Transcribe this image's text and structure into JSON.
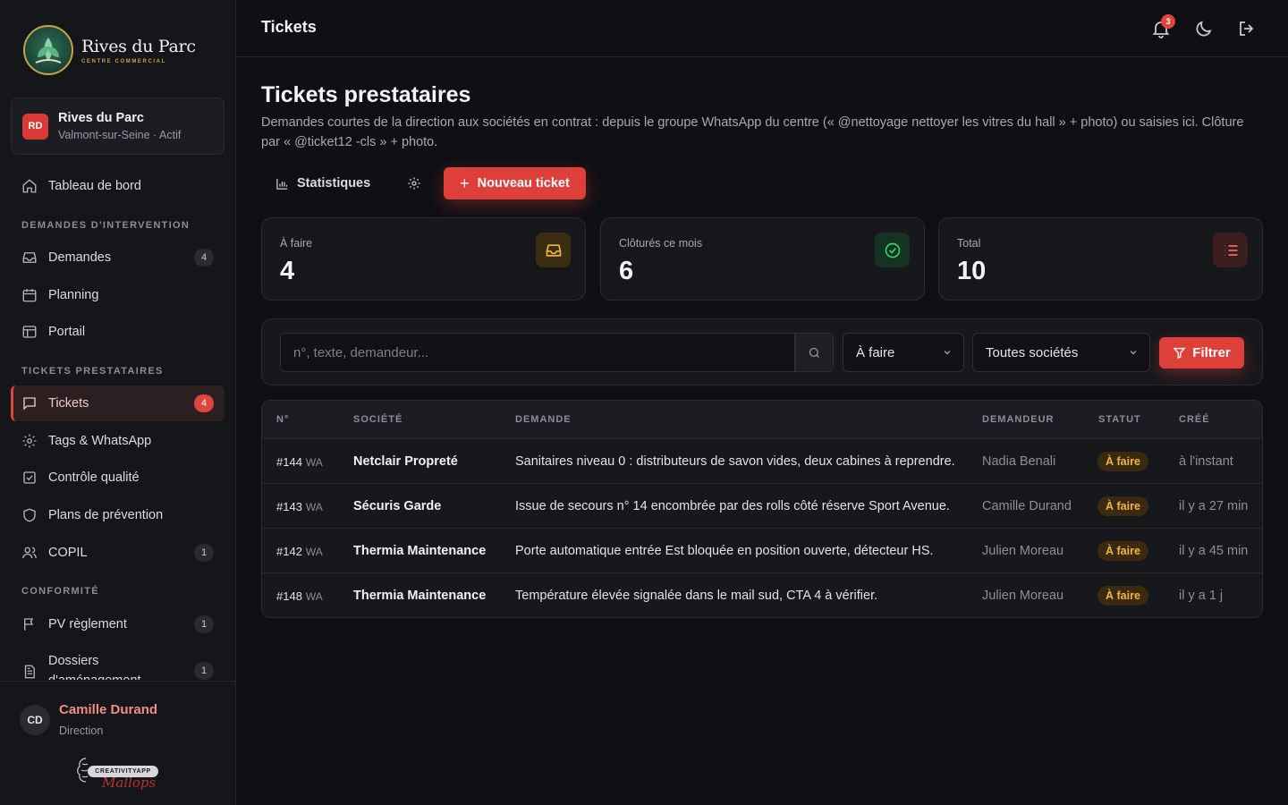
{
  "brand": {
    "name": "Rives du Parc",
    "subtitle": "CENTRE COMMERCIAL"
  },
  "org": {
    "initials": "RD",
    "name": "Rives du Parc",
    "meta": "Valmont-sur-Seine · Actif"
  },
  "nav": {
    "dashboard": "Tableau de bord",
    "section_interventions": "DEMANDES D'INTERVENTION",
    "demandes": {
      "label": "Demandes",
      "count": "4"
    },
    "planning": "Planning",
    "portail": "Portail",
    "section_tickets": "TICKETS PRESTATAIRES",
    "tickets": {
      "label": "Tickets",
      "count": "4"
    },
    "tags": "Tags & WhatsApp",
    "quality": "Contrôle qualité",
    "prevention": "Plans de prévention",
    "copil": {
      "label": "COPIL",
      "count": "1"
    },
    "section_conformity": "CONFORMITÉ",
    "pv": {
      "label": "PV règlement",
      "count": "1"
    },
    "dossiers": {
      "label": "Dossiers d'aménagement",
      "count": "1"
    }
  },
  "user": {
    "initials": "CD",
    "name": "Camille Durand",
    "role": "Direction"
  },
  "made_by": {
    "pill": "CREATIVITYAPP",
    "signature": "Mallops"
  },
  "topbar": {
    "title": "Tickets",
    "notifications": "3"
  },
  "page": {
    "title": "Tickets prestataires",
    "description": "Demandes courtes de la direction aux sociétés en contrat : depuis le groupe WhatsApp du centre (« @nettoyage nettoyer les vitres du hall » + photo) ou saisies ici. Clôture par « @ticket12 -cls » + photo."
  },
  "actions": {
    "stats": "Statistiques",
    "new_ticket": "Nouveau ticket"
  },
  "stats": [
    {
      "label": "À faire",
      "value": "4",
      "color": "#f1b53c"
    },
    {
      "label": "Clôturés ce mois",
      "value": "6",
      "color": "#3ecf6e"
    },
    {
      "label": "Total",
      "value": "10",
      "color": "#ef6b63"
    }
  ],
  "filters": {
    "search_placeholder": "n°, texte, demandeur...",
    "status": "À faire",
    "company": "Toutes sociétés",
    "filter_button": "Filtrer"
  },
  "table": {
    "headers": [
      "N°",
      "SOCIÉTÉ",
      "DEMANDE",
      "DEMANDEUR",
      "STATUT",
      "CRÉÉ"
    ],
    "rows": [
      {
        "num": "#144",
        "source": "WA",
        "company": "Netclair Propreté",
        "request": "Sanitaires niveau 0 : distributeurs de savon vides, deux cabines à reprendre.",
        "requester": "Nadia Benali",
        "status": "À faire",
        "created": "à l'instant"
      },
      {
        "num": "#143",
        "source": "WA",
        "company": "Sécuris Garde",
        "request": "Issue de secours n° 14 encombrée par des rolls côté réserve Sport Avenue.",
        "requester": "Camille Durand",
        "status": "À faire",
        "created": "il y a 27 min"
      },
      {
        "num": "#142",
        "source": "WA",
        "company": "Thermia Maintenance",
        "request": "Porte automatique entrée Est bloquée en position ouverte, détecteur HS.",
        "requester": "Julien Moreau",
        "status": "À faire",
        "created": "il y a 45 min"
      },
      {
        "num": "#148",
        "source": "WA",
        "company": "Thermia Maintenance",
        "request": "Température élevée signalée dans le mail sud, CTA 4 à vérifier.",
        "requester": "Julien Moreau",
        "status": "À faire",
        "created": "il y a 1 j"
      }
    ]
  }
}
